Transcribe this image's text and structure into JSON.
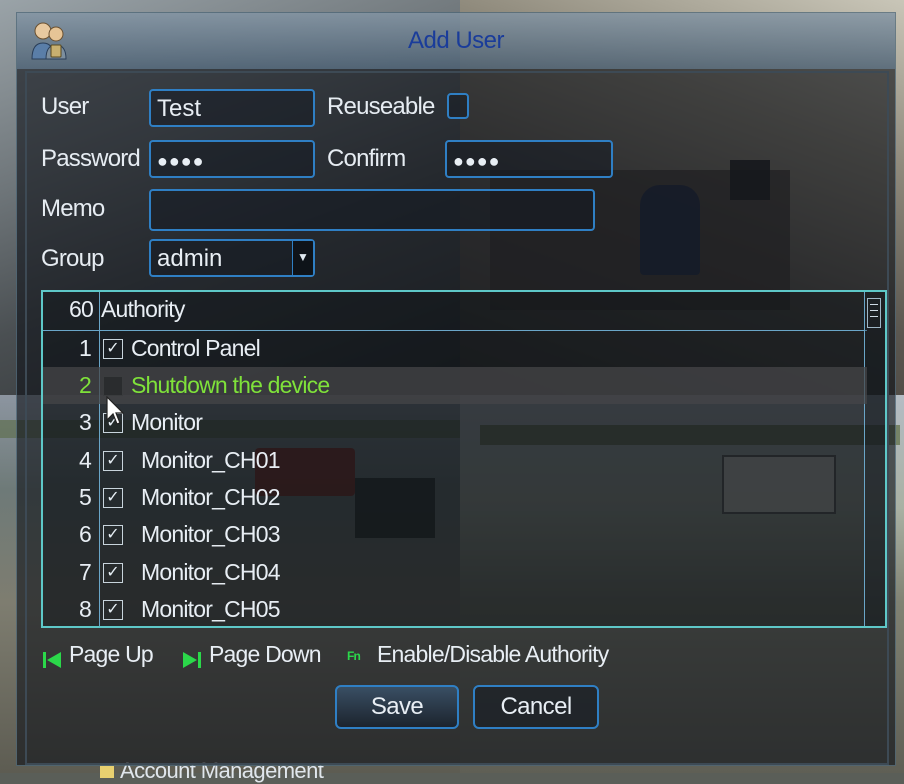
{
  "dialog": {
    "title": "Add User"
  },
  "form": {
    "user_label": "User",
    "user_value": "Test",
    "reuseable_label": "Reuseable",
    "password_label": "Password",
    "password_value": "●●●●",
    "confirm_label": "Confirm",
    "confirm_value": "●●●●",
    "memo_label": "Memo",
    "memo_value": "",
    "group_label": "Group",
    "group_value": "admin"
  },
  "authority": {
    "count": "60",
    "column": "Authority",
    "rows": [
      {
        "num": "1",
        "label": "Control Panel",
        "checked": true
      },
      {
        "num": "2",
        "label": "Shutdown the device",
        "checked": false,
        "selected": true
      },
      {
        "num": "3",
        "label": "Monitor",
        "checked": true
      },
      {
        "num": "4",
        "label": "Monitor_CH01",
        "checked": true
      },
      {
        "num": "5",
        "label": "Monitor_CH02",
        "checked": true
      },
      {
        "num": "6",
        "label": "Monitor_CH03",
        "checked": true
      },
      {
        "num": "7",
        "label": "Monitor_CH04",
        "checked": true
      },
      {
        "num": "8",
        "label": "Monitor_CH05",
        "checked": true
      }
    ]
  },
  "hints": {
    "page_up": "Page Up",
    "page_down": "Page Down",
    "fn_icon": "Fn",
    "enable_disable": "Enable/Disable Authority"
  },
  "buttons": {
    "save": "Save",
    "cancel": "Cancel"
  },
  "background_menu": {
    "account_management": "Account Management"
  },
  "colors": {
    "accent_border": "#2f7fc4",
    "table_border": "#5ec8c8",
    "selected_text": "#7fe23a",
    "title_text": "#1a3c9a",
    "hint_icon": "#2bd84a"
  },
  "icons": {
    "title": "users-icon",
    "page_up": "page-up-icon",
    "page_down": "page-down-icon",
    "fn": "fn-key-icon",
    "cursor": "mouse-cursor-icon",
    "check": "checkmark-icon",
    "dropdown": "chevron-down-icon"
  }
}
